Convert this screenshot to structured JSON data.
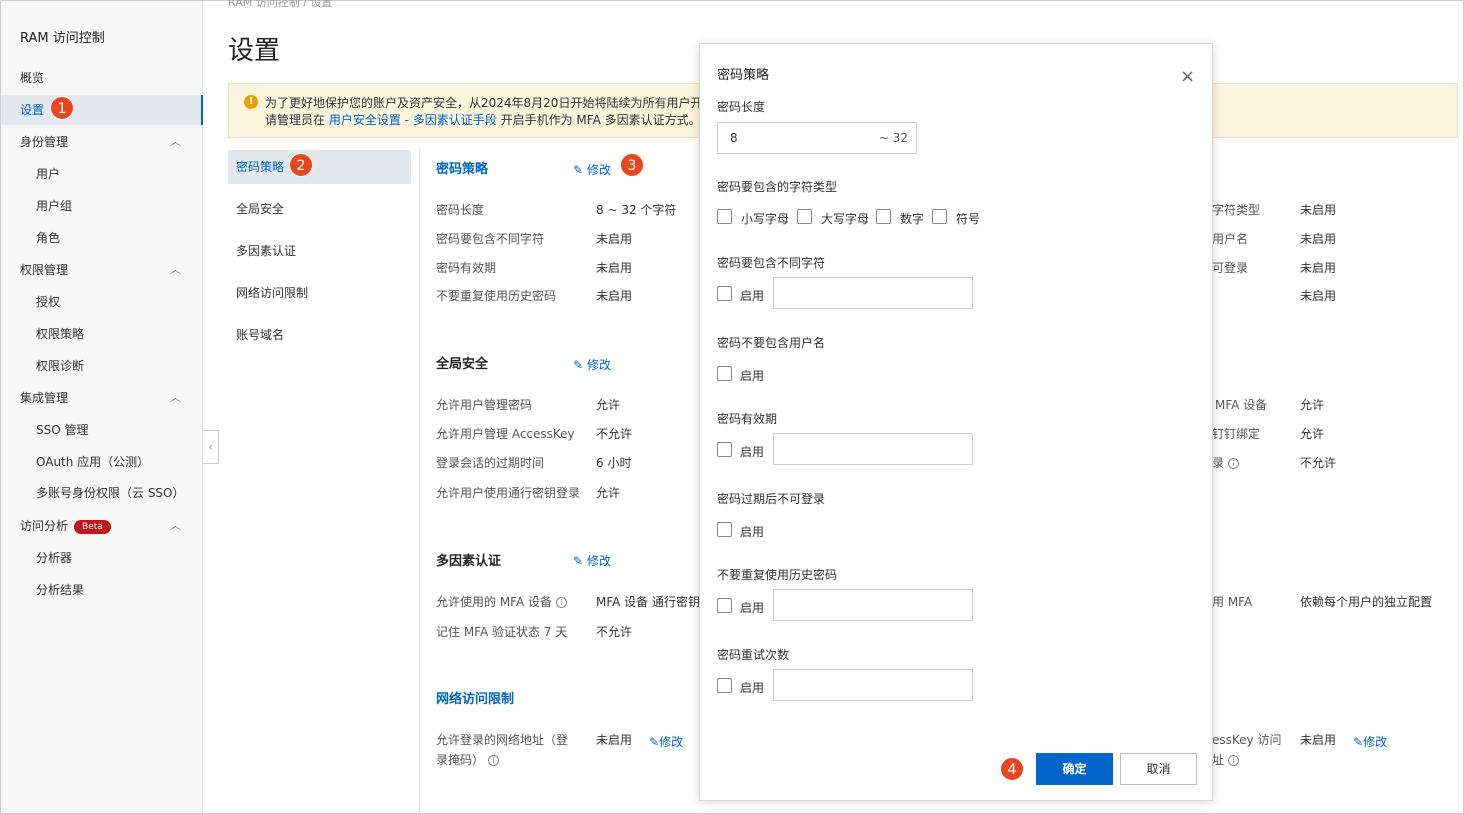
{
  "sidebar": {
    "title": "RAM 访问控制",
    "items": [
      {
        "label": "概览"
      },
      {
        "label": "设置"
      },
      {
        "label": "身份管理",
        "chevron": "^"
      },
      {
        "label": "用户"
      },
      {
        "label": "用户组"
      },
      {
        "label": "角色"
      },
      {
        "label": "权限管理",
        "chevron": "^"
      },
      {
        "label": "授权"
      },
      {
        "label": "权限策略"
      },
      {
        "label": "权限诊断"
      },
      {
        "label": "集成管理",
        "chevron": "^"
      },
      {
        "label": "SSO 管理"
      },
      {
        "label": "OAuth 应用（公测）"
      },
      {
        "label": "多账号身份权限（云 SSO）"
      },
      {
        "label": "访问分析",
        "chevron": "^",
        "badge": "Beta"
      },
      {
        "label": "分析器"
      },
      {
        "label": "分析结果"
      }
    ],
    "collapse_glyph": "‹"
  },
  "header": {
    "breadcrumb": "RAM 访问控制   /   设置",
    "title": "设置"
  },
  "notice": {
    "icon": "!",
    "line1": "为了更好地保护您的账户及资产安全，从2024年8月20日开始将陆续为所有用户开启",
    "line2_prefix": "请管理员在 ",
    "line2_link": "用户安全设置 - 多因素认证手段",
    "line2_suffix": " 开启手机作为 MFA 多因素认证方式。"
  },
  "subnav": [
    {
      "label": "密码策略"
    },
    {
      "label": "全局安全"
    },
    {
      "label": "多因素认证"
    },
    {
      "label": "网络访问限制"
    },
    {
      "label": "账号域名"
    }
  ],
  "edit_label": "修改",
  "edit_icon": "✎",
  "info_icon": "i",
  "sections": {
    "password": {
      "title": "密码策略",
      "rows": [
        {
          "label": "密码长度",
          "value": "8 ~ 32 个字符"
        },
        {
          "label": "密码要包含不同字符",
          "value": "未启用"
        },
        {
          "label": "密码有效期",
          "value": "未启用"
        },
        {
          "label": "不要重复使用历史密码",
          "value": "未启用"
        }
      ],
      "right_rows": [
        {
          "label": "字符类型",
          "value": "未启用"
        },
        {
          "label": "用户名",
          "value": "未启用"
        },
        {
          "label": "可登录",
          "value": "未启用"
        },
        {
          "label": "",
          "value": "未启用"
        }
      ]
    },
    "global": {
      "title": "全局安全",
      "rows": [
        {
          "label": "允许用户管理密码",
          "value": "允许"
        },
        {
          "label": "允许用户管理 AccessKey",
          "value": "不允许"
        },
        {
          "label": "登录会话的过期时间",
          "value": "6 小时"
        },
        {
          "label": "允许用户使用通行密钥登录",
          "value": "允许"
        }
      ],
      "right_rows": [
        {
          "label": "MFA 设备",
          "value": "允许"
        },
        {
          "label": "钉钉绑定",
          "value": "允许"
        },
        {
          "label": "录",
          "value": "不允许"
        }
      ]
    },
    "mfa": {
      "title": "多因素认证",
      "rows": [
        {
          "label": "允许使用的 MFA 设备",
          "value": "MFA 设备   通行密钥"
        },
        {
          "label": "记住 MFA 验证状态 7 天",
          "value": "不允许"
        }
      ],
      "right_rows": [
        {
          "label": "用 MFA",
          "value": "依赖每个用户的独立配置"
        }
      ]
    },
    "network": {
      "title": "网络访问限制",
      "row_label_1": "允许登录的网络地址（登",
      "row_label_2": "录掩码）",
      "row_value": "未启用",
      "right_label_1": "essKey 访问",
      "right_label_2": "址",
      "right_value": "未启用"
    }
  },
  "modal": {
    "title": "密码策略",
    "close_glyph": "×",
    "length_label": "密码长度",
    "length_value": "8",
    "length_suffix": "~ 32",
    "char_types_label": "密码要包含的字符类型",
    "char_types": [
      "小写字母",
      "大写字母",
      "数字",
      "符号"
    ],
    "enable_label": "启用",
    "fields": [
      {
        "label": "密码要包含不同字符"
      },
      {
        "label": "密码不要包含用户名"
      },
      {
        "label": "密码有效期"
      },
      {
        "label": "密码过期后不可登录"
      },
      {
        "label": "不要重复使用历史密码"
      },
      {
        "label": "密码重试次数"
      }
    ],
    "confirm_label": "确定",
    "cancel_label": "取消"
  },
  "markers": [
    "1",
    "2",
    "3",
    "4"
  ],
  "colors": {
    "accent": "#0064c8",
    "marker": "#e8461f",
    "notice_bg": "#fbf4dc"
  }
}
